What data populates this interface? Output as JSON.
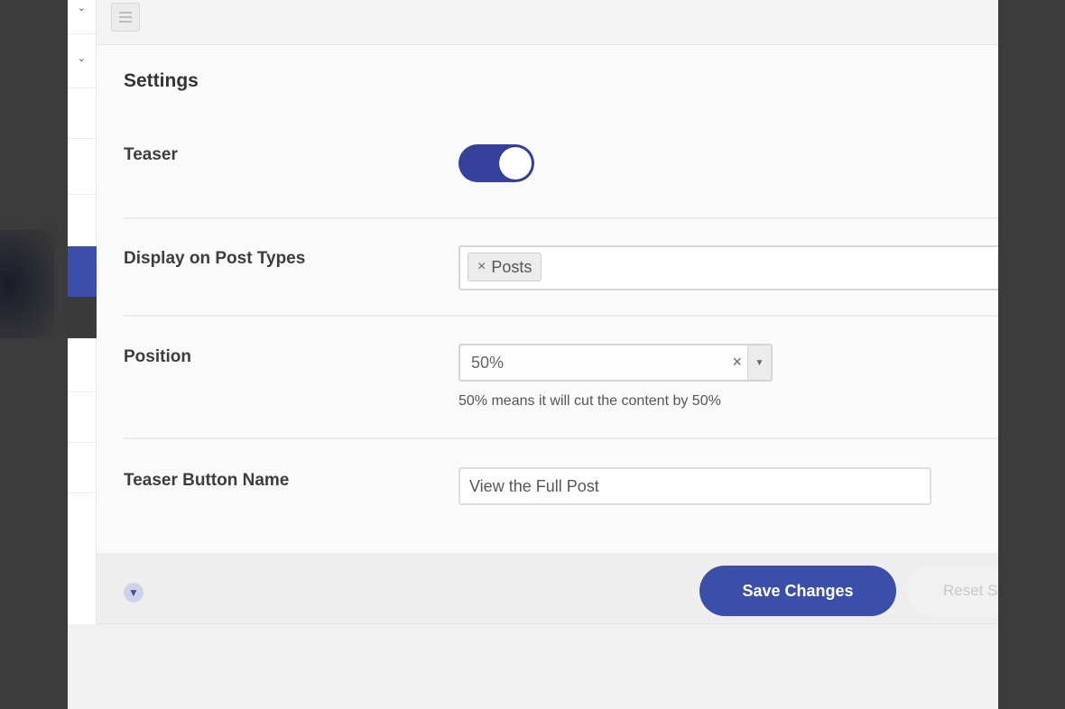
{
  "panel": {
    "title": "Settings",
    "rows": {
      "teaser": {
        "label": "Teaser",
        "enabled": true
      },
      "post_types": {
        "label": "Display on Post Types",
        "chips": [
          {
            "remove": "×",
            "label": "Posts"
          }
        ]
      },
      "position": {
        "label": "Position",
        "value": "50%",
        "clear": "×",
        "help": "50% means it will cut the content by 50%"
      },
      "button_name": {
        "label": "Teaser Button Name",
        "value": "View the Full Post"
      }
    }
  },
  "footer": {
    "save_label": "Save Changes",
    "reset_label": "Reset S"
  },
  "colors": {
    "accent": "#3c4fa8",
    "toggle_on": "#34429a"
  }
}
